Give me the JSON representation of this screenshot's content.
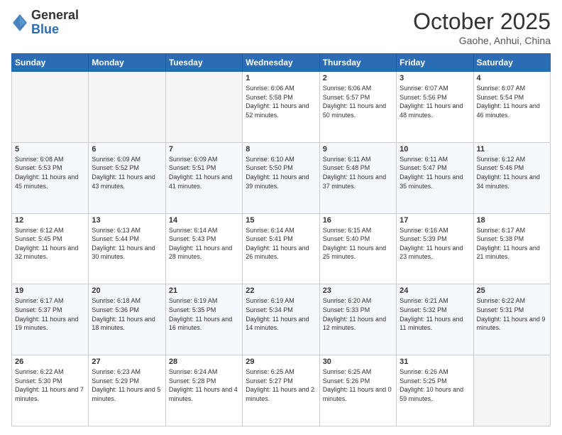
{
  "header": {
    "logo": {
      "general": "General",
      "blue": "Blue"
    },
    "title": "October 2025",
    "location": "Gaohe, Anhui, China"
  },
  "weekdays": [
    "Sunday",
    "Monday",
    "Tuesday",
    "Wednesday",
    "Thursday",
    "Friday",
    "Saturday"
  ],
  "weeks": [
    [
      {
        "day": "",
        "empty": true
      },
      {
        "day": "",
        "empty": true
      },
      {
        "day": "",
        "empty": true
      },
      {
        "day": "1",
        "sunrise": "6:06 AM",
        "sunset": "5:58 PM",
        "daylight": "11 hours and 52 minutes."
      },
      {
        "day": "2",
        "sunrise": "6:06 AM",
        "sunset": "5:57 PM",
        "daylight": "11 hours and 50 minutes."
      },
      {
        "day": "3",
        "sunrise": "6:07 AM",
        "sunset": "5:56 PM",
        "daylight": "11 hours and 48 minutes."
      },
      {
        "day": "4",
        "sunrise": "6:07 AM",
        "sunset": "5:54 PM",
        "daylight": "11 hours and 46 minutes."
      }
    ],
    [
      {
        "day": "5",
        "sunrise": "6:08 AM",
        "sunset": "5:53 PM",
        "daylight": "11 hours and 45 minutes."
      },
      {
        "day": "6",
        "sunrise": "6:09 AM",
        "sunset": "5:52 PM",
        "daylight": "11 hours and 43 minutes."
      },
      {
        "day": "7",
        "sunrise": "6:09 AM",
        "sunset": "5:51 PM",
        "daylight": "11 hours and 41 minutes."
      },
      {
        "day": "8",
        "sunrise": "6:10 AM",
        "sunset": "5:50 PM",
        "daylight": "11 hours and 39 minutes."
      },
      {
        "day": "9",
        "sunrise": "6:11 AM",
        "sunset": "5:48 PM",
        "daylight": "11 hours and 37 minutes."
      },
      {
        "day": "10",
        "sunrise": "6:11 AM",
        "sunset": "5:47 PM",
        "daylight": "11 hours and 35 minutes."
      },
      {
        "day": "11",
        "sunrise": "6:12 AM",
        "sunset": "5:46 PM",
        "daylight": "11 hours and 34 minutes."
      }
    ],
    [
      {
        "day": "12",
        "sunrise": "6:12 AM",
        "sunset": "5:45 PM",
        "daylight": "11 hours and 32 minutes."
      },
      {
        "day": "13",
        "sunrise": "6:13 AM",
        "sunset": "5:44 PM",
        "daylight": "11 hours and 30 minutes."
      },
      {
        "day": "14",
        "sunrise": "6:14 AM",
        "sunset": "5:43 PM",
        "daylight": "11 hours and 28 minutes."
      },
      {
        "day": "15",
        "sunrise": "6:14 AM",
        "sunset": "5:41 PM",
        "daylight": "11 hours and 26 minutes."
      },
      {
        "day": "16",
        "sunrise": "6:15 AM",
        "sunset": "5:40 PM",
        "daylight": "11 hours and 25 minutes."
      },
      {
        "day": "17",
        "sunrise": "6:16 AM",
        "sunset": "5:39 PM",
        "daylight": "11 hours and 23 minutes."
      },
      {
        "day": "18",
        "sunrise": "6:17 AM",
        "sunset": "5:38 PM",
        "daylight": "11 hours and 21 minutes."
      }
    ],
    [
      {
        "day": "19",
        "sunrise": "6:17 AM",
        "sunset": "5:37 PM",
        "daylight": "11 hours and 19 minutes."
      },
      {
        "day": "20",
        "sunrise": "6:18 AM",
        "sunset": "5:36 PM",
        "daylight": "11 hours and 18 minutes."
      },
      {
        "day": "21",
        "sunrise": "6:19 AM",
        "sunset": "5:35 PM",
        "daylight": "11 hours and 16 minutes."
      },
      {
        "day": "22",
        "sunrise": "6:19 AM",
        "sunset": "5:34 PM",
        "daylight": "11 hours and 14 minutes."
      },
      {
        "day": "23",
        "sunrise": "6:20 AM",
        "sunset": "5:33 PM",
        "daylight": "11 hours and 12 minutes."
      },
      {
        "day": "24",
        "sunrise": "6:21 AM",
        "sunset": "5:32 PM",
        "daylight": "11 hours and 11 minutes."
      },
      {
        "day": "25",
        "sunrise": "6:22 AM",
        "sunset": "5:31 PM",
        "daylight": "11 hours and 9 minutes."
      }
    ],
    [
      {
        "day": "26",
        "sunrise": "6:22 AM",
        "sunset": "5:30 PM",
        "daylight": "11 hours and 7 minutes."
      },
      {
        "day": "27",
        "sunrise": "6:23 AM",
        "sunset": "5:29 PM",
        "daylight": "11 hours and 5 minutes."
      },
      {
        "day": "28",
        "sunrise": "6:24 AM",
        "sunset": "5:28 PM",
        "daylight": "11 hours and 4 minutes."
      },
      {
        "day": "29",
        "sunrise": "6:25 AM",
        "sunset": "5:27 PM",
        "daylight": "11 hours and 2 minutes."
      },
      {
        "day": "30",
        "sunrise": "6:25 AM",
        "sunset": "5:26 PM",
        "daylight": "11 hours and 0 minutes."
      },
      {
        "day": "31",
        "sunrise": "6:26 AM",
        "sunset": "5:25 PM",
        "daylight": "10 hours and 59 minutes."
      },
      {
        "day": "",
        "empty": true
      }
    ]
  ],
  "labels": {
    "sunrise": "Sunrise:",
    "sunset": "Sunset:",
    "daylight": "Daylight hours"
  }
}
